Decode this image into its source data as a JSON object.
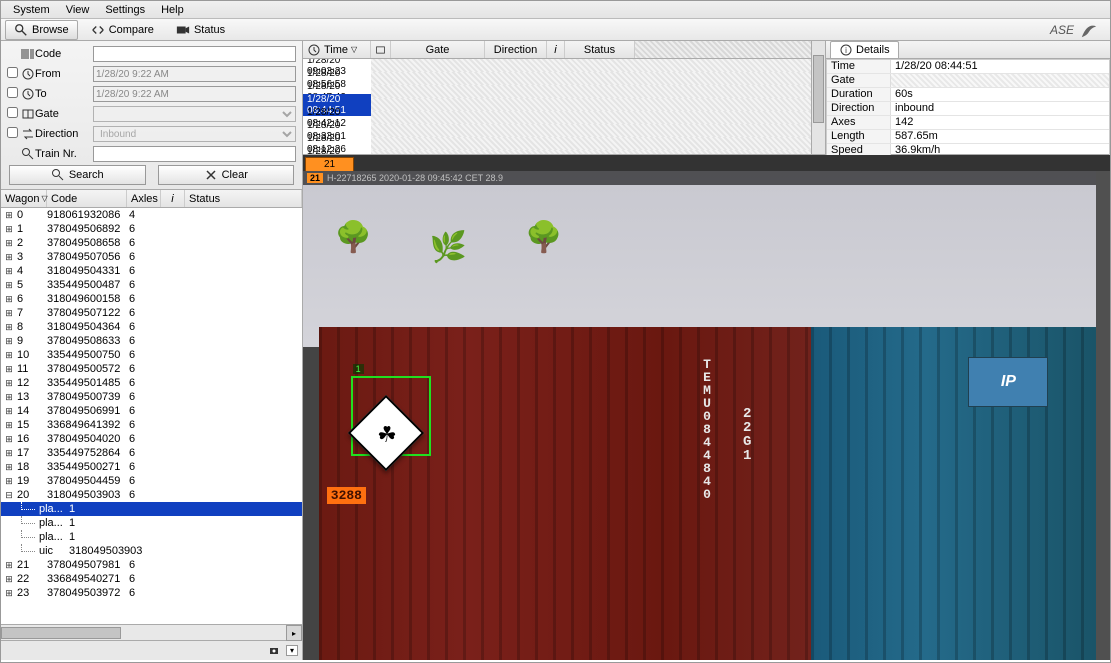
{
  "menu": {
    "system": "System",
    "view": "View",
    "settings": "Settings",
    "help": "Help"
  },
  "toolbar": {
    "browse": "Browse",
    "compare": "Compare",
    "status": "Status",
    "logo": "ASE"
  },
  "filters": {
    "code": "Code",
    "from": "From",
    "from_val": "1/28/20 9:22 AM",
    "to": "To",
    "to_val": "1/28/20 9:22 AM",
    "gate": "Gate",
    "direction": "Direction",
    "direction_val": "Inbound",
    "train_nr": "Train Nr.",
    "search": "Search",
    "clear": "Clear"
  },
  "wagon_headers": {
    "wagon": "Wagon",
    "code": "Code",
    "axles": "Axles",
    "i": "i",
    "status": "Status"
  },
  "wagons": [
    {
      "n": "0",
      "code": "918061932086",
      "ax": "4"
    },
    {
      "n": "1",
      "code": "378049506892",
      "ax": "6"
    },
    {
      "n": "2",
      "code": "378049508658",
      "ax": "6"
    },
    {
      "n": "3",
      "code": "378049507056",
      "ax": "6"
    },
    {
      "n": "4",
      "code": "318049504331",
      "ax": "6"
    },
    {
      "n": "5",
      "code": "335449500487",
      "ax": "6"
    },
    {
      "n": "6",
      "code": "318049600158",
      "ax": "6"
    },
    {
      "n": "7",
      "code": "378049507122",
      "ax": "6"
    },
    {
      "n": "8",
      "code": "318049504364",
      "ax": "6"
    },
    {
      "n": "9",
      "code": "378049508633",
      "ax": "6"
    },
    {
      "n": "10",
      "code": "335449500750",
      "ax": "6"
    },
    {
      "n": "11",
      "code": "378049500572",
      "ax": "6"
    },
    {
      "n": "12",
      "code": "335449501485",
      "ax": "6"
    },
    {
      "n": "13",
      "code": "378049500739",
      "ax": "6"
    },
    {
      "n": "14",
      "code": "378049506991",
      "ax": "6"
    },
    {
      "n": "15",
      "code": "336849641392",
      "ax": "6"
    },
    {
      "n": "16",
      "code": "378049504020",
      "ax": "6"
    },
    {
      "n": "17",
      "code": "335449752864",
      "ax": "6"
    },
    {
      "n": "18",
      "code": "335449500271",
      "ax": "6"
    },
    {
      "n": "19",
      "code": "378049504459",
      "ax": "6"
    },
    {
      "n": "20",
      "code": "318049503903",
      "ax": "6"
    },
    {
      "n": "21",
      "code": "378049507981",
      "ax": "6"
    },
    {
      "n": "22",
      "code": "336849540271",
      "ax": "6"
    },
    {
      "n": "23",
      "code": "378049503972",
      "ax": "6"
    }
  ],
  "wagon20_children": [
    {
      "label": "pla...",
      "val": "1",
      "selected": true
    },
    {
      "label": "pla...",
      "val": "1"
    },
    {
      "label": "pla...",
      "val": "1"
    },
    {
      "label": "uic",
      "val": "318049503903"
    }
  ],
  "rec_headers": {
    "time": "Time",
    "gate": "Gate",
    "direction": "Direction",
    "i": "i",
    "status": "Status"
  },
  "records": [
    {
      "t": "1/28/20 09:03:23"
    },
    {
      "t": "1/28/20 08:56:58"
    },
    {
      "t": "1/28/20 08:47:42"
    },
    {
      "t": "1/28/20 08:44:51",
      "selected": true
    },
    {
      "t": "1/28/20 08:42:12"
    },
    {
      "t": "1/28/20 08:33:01"
    },
    {
      "t": "1/28/20 08:12:26"
    },
    {
      "t": "1/28/20 08:09:24"
    }
  ],
  "details": {
    "tab": "Details",
    "rows": {
      "time_k": "Time",
      "time_v": "1/28/20 08:44:51",
      "gate_k": "Gate",
      "duration_k": "Duration",
      "duration_v": "60s",
      "direction_k": "Direction",
      "direction_v": "inbound",
      "axes_k": "Axes",
      "axes_v": "142",
      "length_k": "Length",
      "length_v": "587.65m",
      "speed_k": "Speed",
      "speed_v": "36.9km/h"
    }
  },
  "image": {
    "tab": "21",
    "overlay_tag": "21",
    "overlay_text": "H-22718265 2020-01-28 09:45:42 CET 28.9",
    "container_id": "TEMU0844840",
    "container_type": "22G1",
    "corner_num": "3288",
    "blue_plate": "IP"
  }
}
